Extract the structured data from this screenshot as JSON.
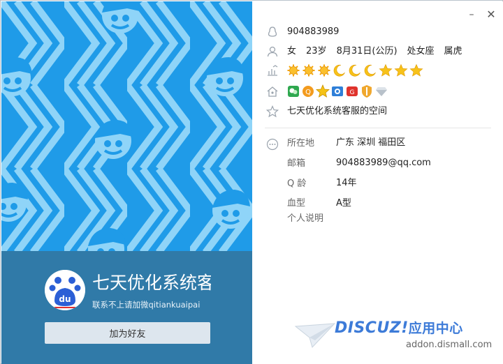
{
  "profile": {
    "qq_number": "904883989",
    "gender": "女",
    "age": "23岁",
    "birthday": "8月31日(公历)",
    "constellation": "处女座",
    "zodiac": "属虎",
    "signature": "七天优化系统客服的空间",
    "nickname": "七天优化系统客服",
    "contact_note": "联系不上请加微qitiankuaipai",
    "add_friend_label": "加为好友",
    "avatar_text": "du"
  },
  "level": {
    "suns": 3,
    "moons": 3,
    "stars": 3
  },
  "badges": [
    "wechat-badge-icon",
    "coin-badge-icon",
    "star-badge-icon",
    "camera-badge-icon",
    "game-badge-icon",
    "shield-badge-icon",
    "diamond-badge-icon"
  ],
  "details": [
    {
      "label": "所在地",
      "value": "广东 深圳 福田区"
    },
    {
      "label": "邮箱",
      "value": "904883989@qq.com"
    },
    {
      "label": "Q 龄",
      "value": "14年"
    },
    {
      "label": "血型",
      "value": "A型"
    },
    {
      "label": "个人说明",
      "value": ""
    }
  ],
  "window": {
    "minimize": "–",
    "close": "✕"
  },
  "watermark": {
    "brand": "DISCUZ!",
    "brand_cn": "应用中心",
    "url": "addon.dismall.com"
  },
  "colors": {
    "cover_blue": "#1f9be8",
    "cover_light": "#8fd4f8",
    "panel": "#307aa8",
    "button": "#dde6ee",
    "baidu_blue": "#2b5fd6"
  }
}
